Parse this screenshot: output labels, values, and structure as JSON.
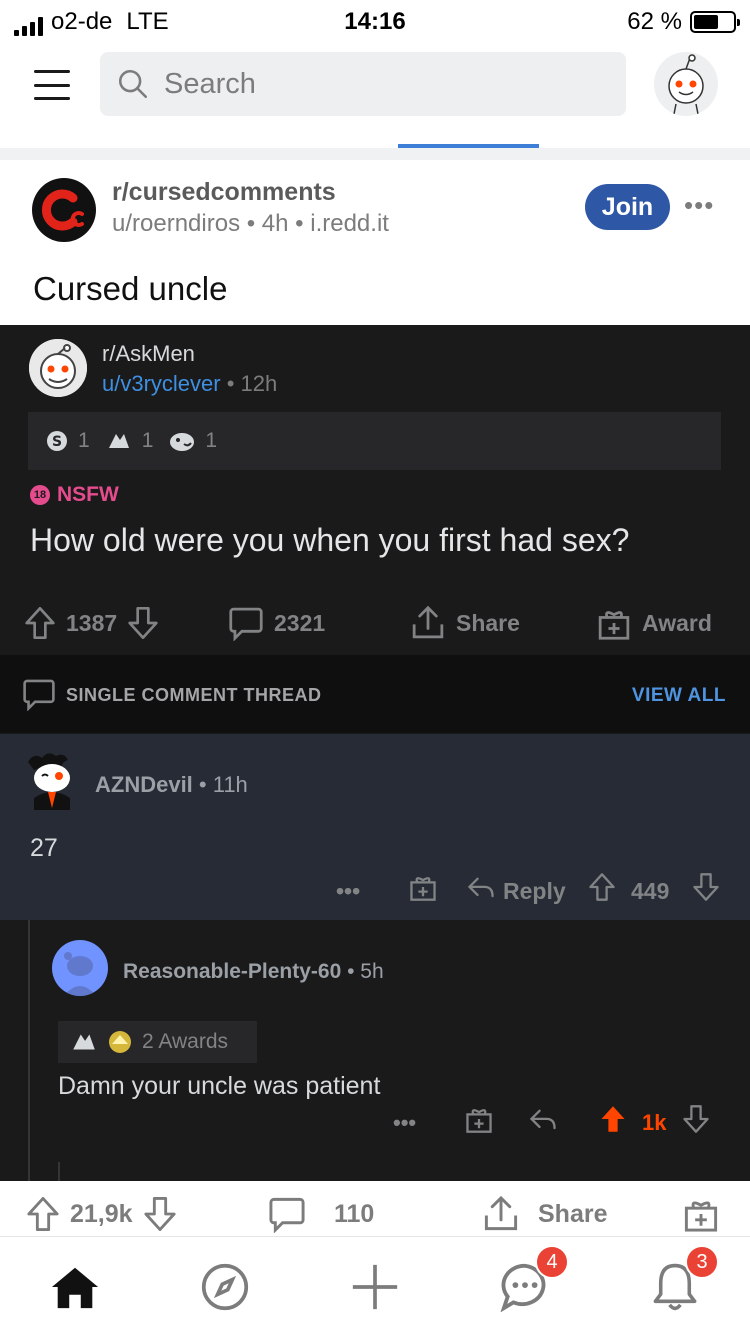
{
  "status_bar": {
    "carrier": "o2-de",
    "network": "LTE",
    "time": "14:16",
    "battery": "62 %",
    "battery_level": 0.62
  },
  "top_bar": {
    "search_placeholder": "Search"
  },
  "post": {
    "subreddit": "r/cursedcomments",
    "meta": "u/roerndiros • 4h • i.redd.it",
    "join_label": "Join",
    "more_label": "•••",
    "title": "Cursed uncle"
  },
  "screenshot": {
    "subreddit": "r/AskMen",
    "user": "u/v3ryclever",
    "age": "• 12h",
    "awards": [
      {
        "icon": "silver-award-icon",
        "count": "1"
      },
      {
        "icon": "wholesome-hands-icon",
        "count": "1"
      },
      {
        "icon": "laugh-award-icon",
        "count": "1"
      }
    ],
    "nsfw_badge": "18",
    "nsfw_label": "NSFW",
    "title": "How old were you when you first had sex?",
    "votes": "1387",
    "comments": "2321",
    "share_label": "Share",
    "award_label": "Award",
    "thread_label": "SINGLE COMMENT THREAD",
    "view_all": "VIEW ALL",
    "comment1": {
      "user": "AZNDevil",
      "age": " • 11h",
      "body": "27",
      "more": "•••",
      "reply": "Reply",
      "votes": "449"
    },
    "comment2": {
      "user": "Reasonable-Plenty-60",
      "age": " • 5h",
      "awards_label": "2 Awards",
      "body": "Damn your uncle was patient",
      "more": "•••",
      "votes": "1k"
    }
  },
  "post_actions": {
    "votes": "21,9k",
    "comments": "110",
    "share": "Share"
  },
  "nav": {
    "chat_badge": "4",
    "inbox_badge": "3"
  },
  "colors": {
    "accent_blue": "#2e57a6",
    "upvote_orange": "#ff4500",
    "nsfw_pink": "#e54c8d",
    "badge_red": "#ea4335"
  }
}
